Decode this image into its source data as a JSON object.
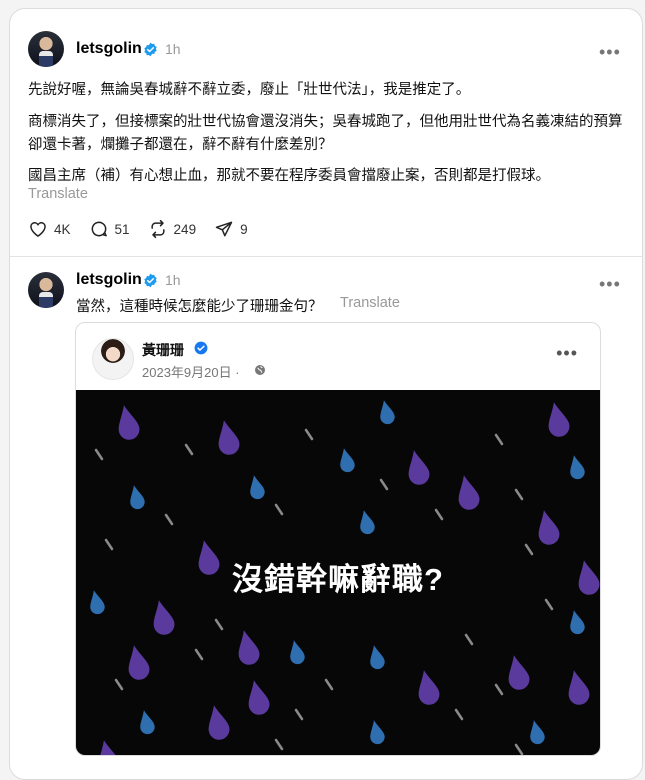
{
  "post1": {
    "username": "letsgolin",
    "time": "1h",
    "paragraphs": [
      "先說好喔，無論吳春城辭不辭立委，廢止「壯世代法」，我是推定了。",
      "商標消失了，但接標案的壯世代協會還沒消失；吳春城跑了，但他用壯世代為名義凍結的預算卻還卡著，爛攤子都還在，辭不辭有什麼差別？",
      "國昌主席（補）有心想止血，那就不要在程序委員會擋廢止案，否則都是打假球。"
    ],
    "translate": "Translate",
    "likes": "4K",
    "comments": "51",
    "reposts": "249",
    "shares": "9"
  },
  "post2": {
    "username": "letsgolin",
    "time": "1h",
    "text": "當然，這種時候怎麼能少了珊珊金句？",
    "translate": "Translate",
    "embed": {
      "name": "黃珊珊",
      "date": "2023年9月20日 ·",
      "image_text": "沒錯幹嘛辭職?"
    }
  },
  "icons": {
    "verified": "verified-badge-icon",
    "like": "heart-icon",
    "comment": "comment-bubble-icon",
    "repost": "repost-icon",
    "share": "send-icon",
    "more": "more-dots-icon",
    "globe": "globe-icon"
  },
  "colors": {
    "verified": "#1d9bf0",
    "rain_purple": "#5b3a9e",
    "rain_blue": "#2f6fb0",
    "rain_gray": "#8a8a8a",
    "image_bg": "#070708"
  }
}
